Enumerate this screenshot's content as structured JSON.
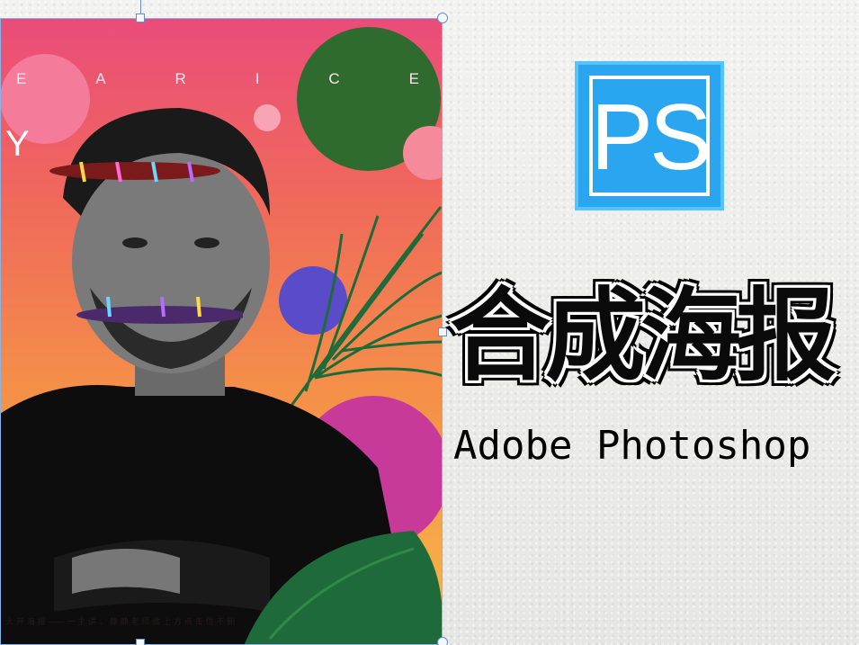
{
  "poster": {
    "top_letters": [
      "E",
      "A",
      "R",
      "I",
      "C",
      "E"
    ],
    "big_letter": "Y",
    "footer_text": "大 开 海 报 —— 一 主 讲 ， 静 静 老 师          做 上 方 点 击 位 不 删"
  },
  "logo": {
    "text": "PS",
    "icon": "photoshop-logo-icon",
    "colors": {
      "fill": "#2aa6f0",
      "border": "#54c4ff",
      "inner": "#ffffff"
    }
  },
  "title": {
    "chinese": "合成海报",
    "english": "Adobe Photoshop"
  }
}
